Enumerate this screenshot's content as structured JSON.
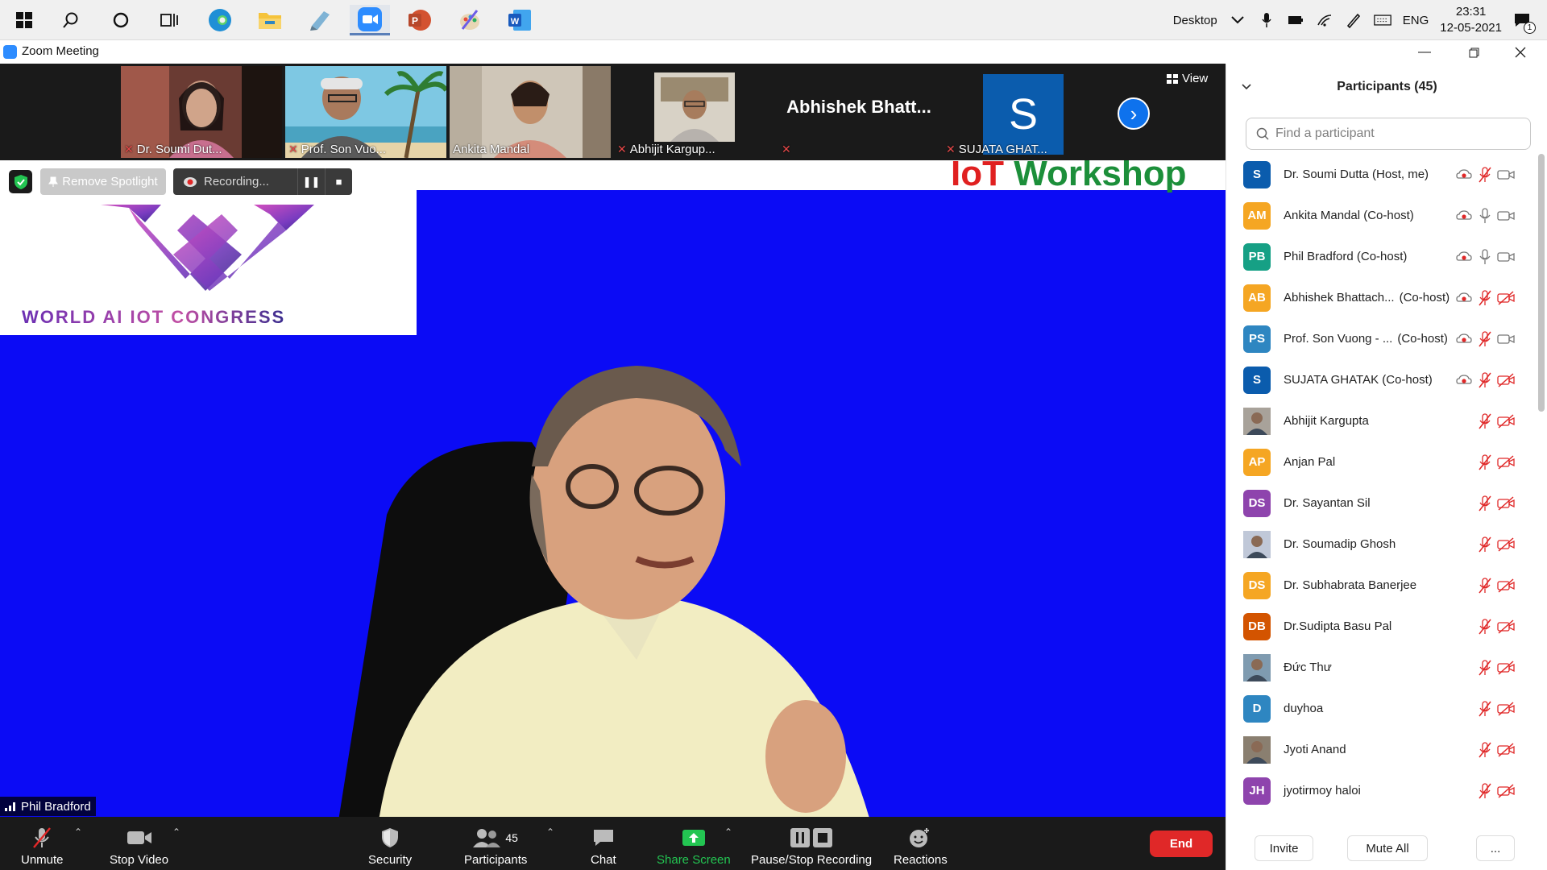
{
  "taskbar": {
    "desktop_label": "Desktop",
    "language": "ENG",
    "time": "23:31",
    "date": "12-05-2021",
    "notification_count": "1"
  },
  "window": {
    "title": "Zoom Meeting"
  },
  "strip": {
    "thumbs": [
      {
        "name": "Dr. Soumi Dut...",
        "muted": true,
        "kind": "video"
      },
      {
        "name": "Prof. Son Vuo...",
        "muted": true,
        "kind": "video"
      },
      {
        "name": "Ankita Mandal",
        "muted": false,
        "kind": "video"
      },
      {
        "name": "Abhijit Kargup...",
        "muted": true,
        "kind": "video"
      },
      {
        "name": "Abhishek  Bhatt...",
        "muted": true,
        "kind": "name-only"
      },
      {
        "name": "SUJATA GHAT...",
        "muted": true,
        "kind": "avatar",
        "avatar_letter": "S"
      }
    ],
    "view_label": "View"
  },
  "main": {
    "remove_spotlight_label": "Remove Spotlight",
    "recording_label": "Recording...",
    "logo_text": "WORLD AI IOT CONGRESS",
    "workshop_iot": "IoT",
    "workshop_word": "Workshop",
    "speaker_name": "Phil Bradford",
    "background_color": "#0b0bf5"
  },
  "toolbar": {
    "unmute": "Unmute",
    "stop_video": "Stop Video",
    "security": "Security",
    "participants": "Participants",
    "participants_count": "45",
    "chat": "Chat",
    "share_screen": "Share Screen",
    "pause_stop_recording": "Pause/Stop Recording",
    "reactions": "Reactions",
    "end": "End"
  },
  "panel": {
    "title": "Participants (45)",
    "search_placeholder": "Find a participant",
    "participants": [
      {
        "initials": "S",
        "color": "#0b5cad",
        "name": "Dr. Soumi Dutta (Host, me)",
        "role": "",
        "rec": true,
        "mic": "muted",
        "video": "off-plain"
      },
      {
        "initials": "AM",
        "color": "#f5a623",
        "name": "Ankita Mandal (Co-host)",
        "role": "",
        "rec": true,
        "mic": "on",
        "video": "off-plain"
      },
      {
        "initials": "PB",
        "color": "#16a085",
        "name": "Phil Bradford (Co-host)",
        "role": "",
        "rec": true,
        "mic": "on",
        "video": "off-plain"
      },
      {
        "initials": "AB",
        "color": "#f5a623",
        "name": "Abhishek Bhattach...",
        "role": "(Co-host)",
        "rec": true,
        "mic": "muted",
        "video": "muted"
      },
      {
        "initials": "PS",
        "color": "#2e86c1",
        "name": "Prof. Son Vuong - ...",
        "role": "(Co-host)",
        "rec": true,
        "mic": "muted",
        "video": "off-plain"
      },
      {
        "initials": "S",
        "color": "#0b5cad",
        "name": "SUJATA GHATAK (Co-host)",
        "role": "",
        "rec": true,
        "mic": "muted",
        "video": "muted"
      },
      {
        "initials": "",
        "color": "#a8a29a",
        "name": "Abhijit Kargupta",
        "role": "",
        "rec": false,
        "mic": "muted",
        "video": "muted",
        "photo": true
      },
      {
        "initials": "AP",
        "color": "#f5a623",
        "name": "Anjan Pal",
        "role": "",
        "rec": false,
        "mic": "muted",
        "video": "muted"
      },
      {
        "initials": "DS",
        "color": "#8e44ad",
        "name": "Dr. Sayantan Sil",
        "role": "",
        "rec": false,
        "mic": "muted",
        "video": "muted"
      },
      {
        "initials": "",
        "color": "#c0c8d8",
        "name": "Dr. Soumadip Ghosh",
        "role": "",
        "rec": false,
        "mic": "muted",
        "video": "muted",
        "photo": true
      },
      {
        "initials": "DS",
        "color": "#f5a623",
        "name": "Dr. Subhabrata Banerjee",
        "role": "",
        "rec": false,
        "mic": "muted",
        "video": "muted"
      },
      {
        "initials": "DB",
        "color": "#d35400",
        "name": "Dr.Sudipta Basu Pal",
        "role": "",
        "rec": false,
        "mic": "muted",
        "video": "muted"
      },
      {
        "initials": "",
        "color": "#7f9bb0",
        "name": "Đức Thư",
        "role": "",
        "rec": false,
        "mic": "muted",
        "video": "muted",
        "photo": true
      },
      {
        "initials": "D",
        "color": "#2e86c1",
        "name": "duyhoa",
        "role": "",
        "rec": false,
        "mic": "muted",
        "video": "muted"
      },
      {
        "initials": "",
        "color": "#8a7f70",
        "name": "Jyoti Anand",
        "role": "",
        "rec": false,
        "mic": "muted",
        "video": "muted",
        "photo": true
      },
      {
        "initials": "JH",
        "color": "#8e44ad",
        "name": "jyotirmoy haloi",
        "role": "",
        "rec": false,
        "mic": "muted",
        "video": "muted"
      }
    ],
    "invite_label": "Invite",
    "mute_all_label": "Mute All",
    "more_label": "..."
  }
}
